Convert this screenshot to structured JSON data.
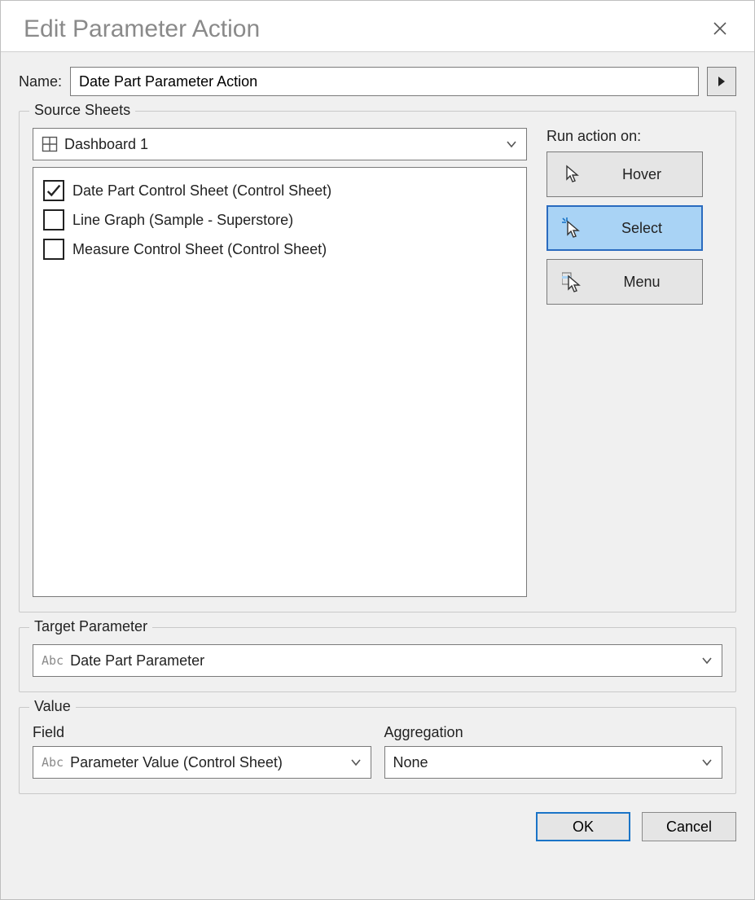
{
  "title": "Edit Parameter Action",
  "name_row": {
    "label": "Name:",
    "value": "Date Part Parameter Action"
  },
  "source": {
    "legend": "Source Sheets",
    "dashboard": "Dashboard 1",
    "sheets": [
      {
        "label": "Date Part Control Sheet (Control Sheet)",
        "checked": true
      },
      {
        "label": "Line Graph (Sample - Superstore)",
        "checked": false
      },
      {
        "label": "Measure Control Sheet (Control Sheet)",
        "checked": false
      }
    ],
    "run_label": "Run action on:",
    "modes": {
      "hover": "Hover",
      "select": "Select",
      "menu": "Menu",
      "selected": "select"
    }
  },
  "target": {
    "legend": "Target Parameter",
    "value": "Date Part Parameter",
    "type_icon": "Abc"
  },
  "value": {
    "legend": "Value",
    "field_label": "Field",
    "aggregation_label": "Aggregation",
    "field_value": "Parameter Value (Control Sheet)",
    "field_type_icon": "Abc",
    "aggregation_value": "None"
  },
  "buttons": {
    "ok": "OK",
    "cancel": "Cancel"
  }
}
